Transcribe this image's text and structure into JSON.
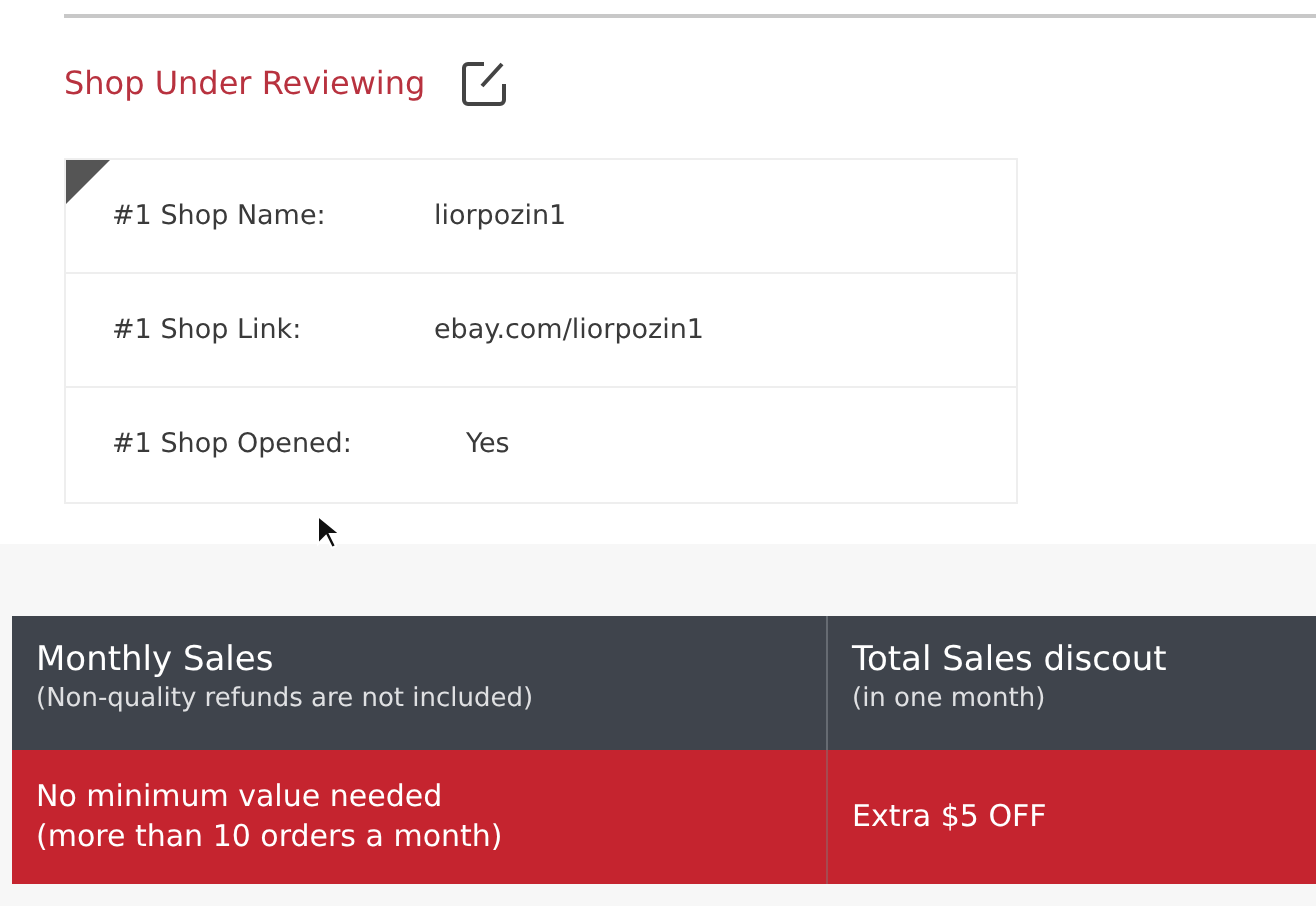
{
  "section": {
    "title": "Shop Under Reviewing",
    "fields": [
      {
        "label": "#1 Shop Name:",
        "value": "liorpozin1"
      },
      {
        "label": "#1 Shop Link:",
        "value": "ebay.com/liorpozin1"
      },
      {
        "label": "#1 Shop Opened:",
        "value": "Yes"
      }
    ]
  },
  "table": {
    "columns": [
      {
        "title": "Monthly Sales",
        "subtitle": "(Non-quality refunds are not included)"
      },
      {
        "title": "Total Sales discout",
        "subtitle": "(in one month)"
      }
    ],
    "rows": [
      {
        "highlighted": true,
        "cells": [
          [
            "No minimum value needed",
            "(more than 10 orders a month)"
          ],
          [
            "Extra $5 OFF"
          ]
        ]
      }
    ]
  }
}
